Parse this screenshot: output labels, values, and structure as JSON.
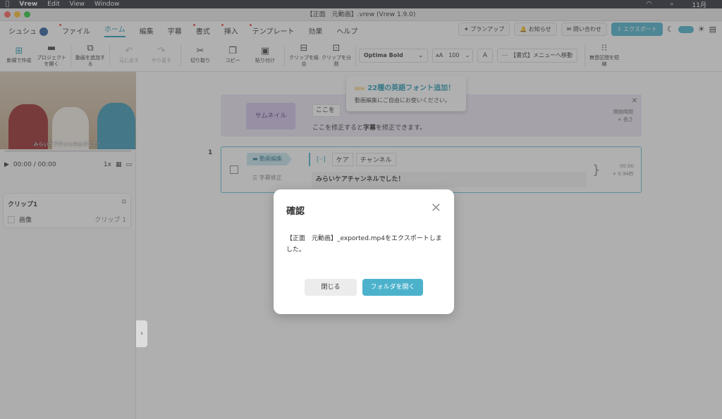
{
  "mac_menu": {
    "app": "Vrew",
    "items": [
      "Edit",
      "View",
      "Window"
    ],
    "clock": "11月"
  },
  "window": {
    "title": "【正面　元動画】.vrew (Vrew 1.9.0)"
  },
  "menubar": {
    "user": "シュシュ",
    "items": [
      {
        "label": "ファイル",
        "dot": true
      },
      {
        "label": "ホーム",
        "active": true
      },
      {
        "label": "編集"
      },
      {
        "label": "字幕"
      },
      {
        "label": "書式",
        "dot": true
      },
      {
        "label": "挿入",
        "dot": true
      },
      {
        "label": "テンプレート",
        "dot": true
      },
      {
        "label": "効果"
      },
      {
        "label": "ヘルプ"
      }
    ]
  },
  "topright": {
    "plan": "プランアップ",
    "notice": "お知らせ",
    "contact": "問い合わせ",
    "export": "エクスポート"
  },
  "toolbar": {
    "new": "新規で作成",
    "open": "プロジェクトを開く",
    "add_video": "動画を追加する",
    "undo": "元に戻す",
    "redo": "やり直す",
    "cut": "切り取り",
    "copy": "コピー",
    "paste": "貼り付け",
    "merge": "クリップを結合",
    "split": "クリップを分割",
    "font": "Optima Bold",
    "size": "100",
    "format_menu": "【書式】メニューへ移動",
    "silence": "無音区間を短縮"
  },
  "tooltip": {
    "badge": "NEW",
    "title": "22種の英語フォント追加！",
    "desc": "動画編集にご自由にお使いください。"
  },
  "player": {
    "subtitle": "みらいケアチャンネルでした！",
    "time": "00:00",
    "total": "/ 00:00",
    "speed": "1x"
  },
  "clip_panel": {
    "title": "クリップ1",
    "row_label": "画像",
    "row_value": "クリップ 1"
  },
  "thumbnail": {
    "button": "サムネイル",
    "input": "ここを",
    "hint_pre": "ここを修正すると",
    "hint_bold": "字幕",
    "hint_post": "を修正できます。",
    "side1": "開始時間",
    "side2": "+ 長さ"
  },
  "clip": {
    "number": "1",
    "tag_edit": "動画編集",
    "tag_sub": "字幕修正",
    "words": [
      "[··]",
      "ケア",
      "チャンネル"
    ],
    "subtitle": "みらいケアチャンネルでした！",
    "time1": "00:00",
    "time2": "+ 0.94秒"
  },
  "dialog": {
    "title": "確認",
    "message": "【正面　元動画】_exported.mp4をエクスポートしました。",
    "close": "閉じる",
    "open_folder": "フォルダを開く"
  }
}
